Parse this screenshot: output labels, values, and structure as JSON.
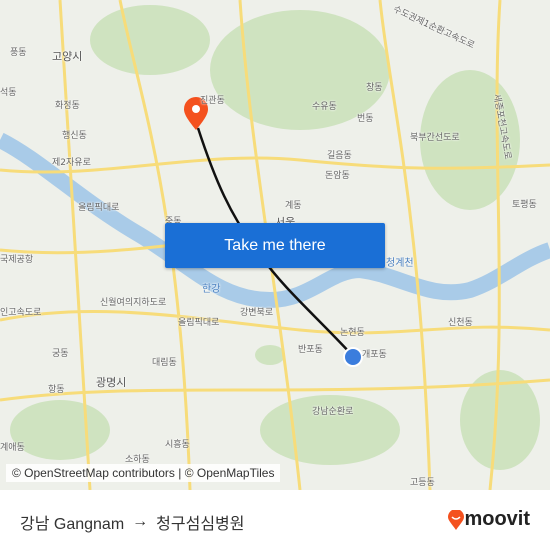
{
  "map": {
    "labels": [
      "고양시",
      "화정동",
      "행신동",
      "제2자유로",
      "풍동",
      "석동",
      "올림픽대로",
      "국제공항",
      "인고속도로",
      "신월여의지하도로",
      "한강",
      "올림픽대로",
      "강변북로",
      "궁동",
      "대림동",
      "광명시",
      "항동",
      "시흥동",
      "소하동",
      "계애동",
      "진관동",
      "수유동",
      "창동",
      "번동",
      "북부간선도로",
      "길음동",
      "돈암동",
      "계동",
      "서울",
      "중동",
      "논현동",
      "반포동",
      "개포동",
      "강남순환로",
      "신천동",
      "토평동",
      "고등동",
      "청계천",
      "세종포천고속도로",
      "수도권제1순환고속도로"
    ],
    "colors": {
      "land": "#eef0ea",
      "park": "#cfe3c0",
      "water": "#a9cbe8",
      "road": "#f7dc7a",
      "route": "#111111",
      "pin": "#f4511e",
      "destination": "#3b7ddd"
    }
  },
  "cta": {
    "label": "Take me there"
  },
  "attribution": "© OpenStreetMap contributors | © OpenMapTiles",
  "footer": {
    "origin": "강남 Gangnam",
    "arrow": "→",
    "destination": "청구섬심병원",
    "logo": "moovit"
  },
  "brand_color": "#f4511e"
}
